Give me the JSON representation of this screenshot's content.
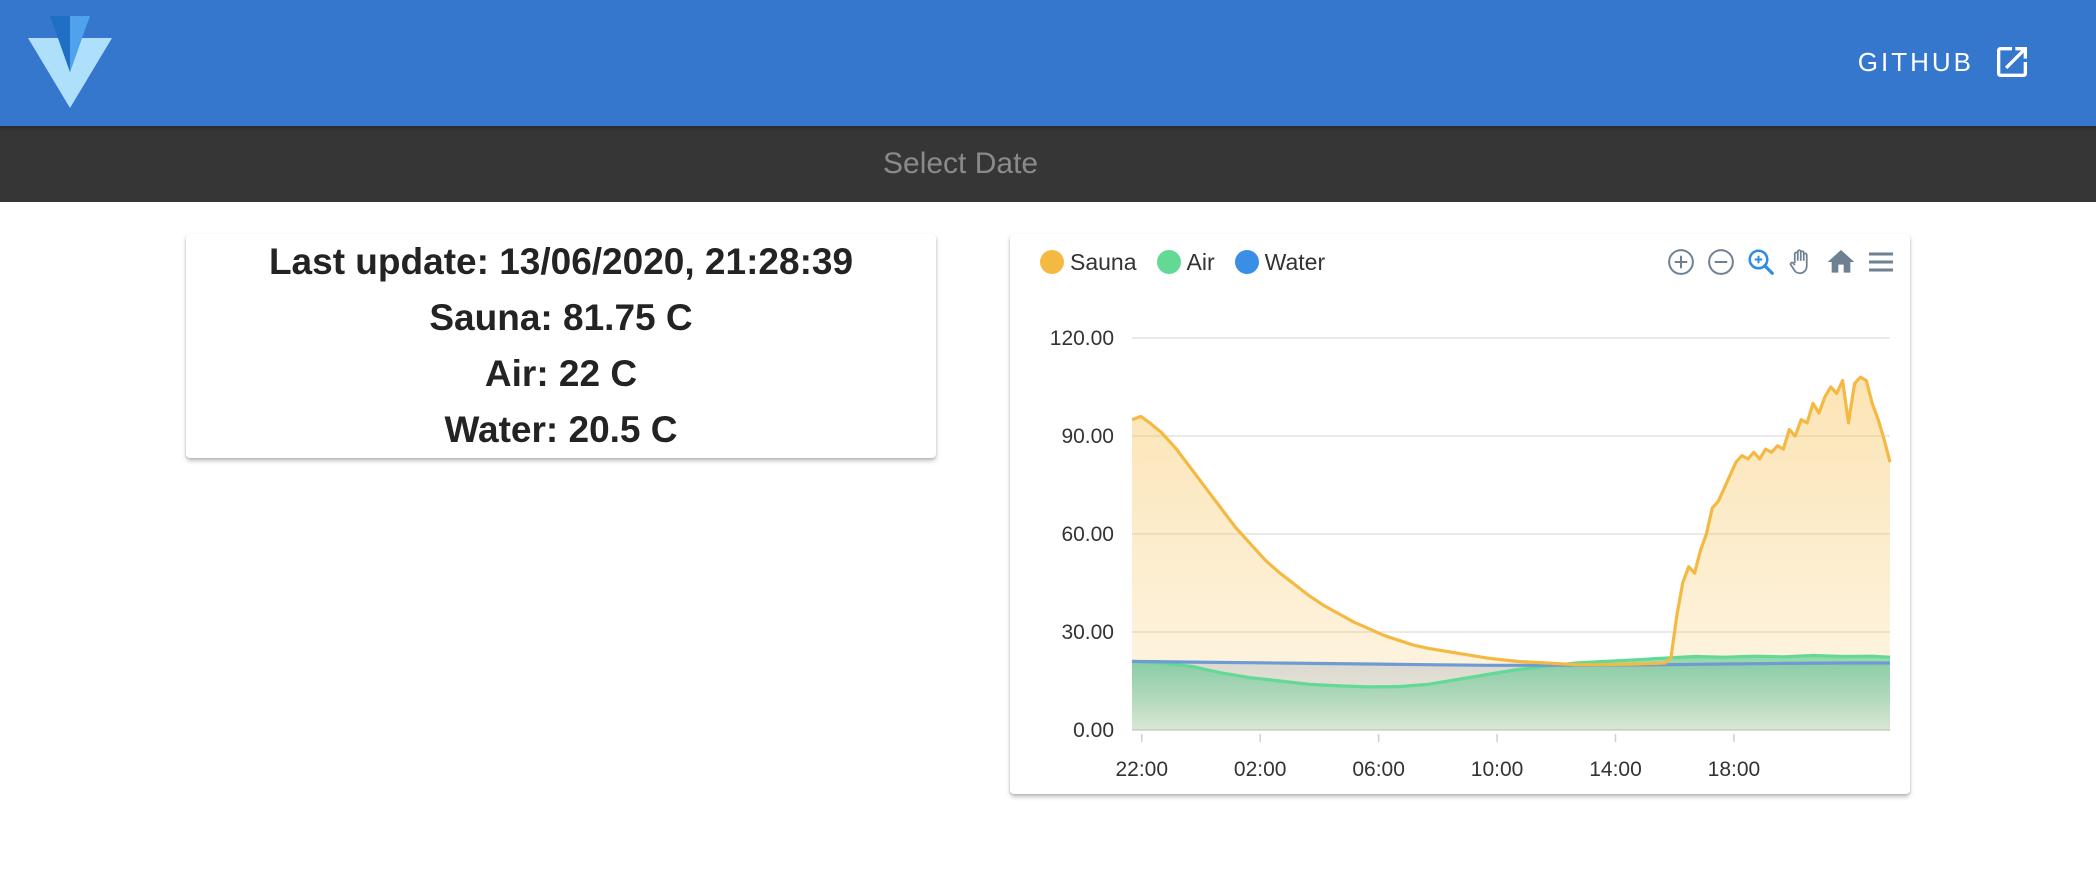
{
  "header": {
    "logo_icon": "vuetify-logo-icon",
    "github_label": "GITHUB",
    "github_icon": "open-in-new-icon",
    "background": "#3477cc"
  },
  "date_picker": {
    "placeholder": "Select Date",
    "value": ""
  },
  "status": {
    "last_update": "Last update: 13/06/2020, 21:28:39",
    "sauna": "Sauna: 81.75 C",
    "air": "Air: 22 C",
    "water": "Water: 20.5 C"
  },
  "toolbar": {
    "icons": [
      "zoom-in-icon",
      "zoom-out-icon",
      "zoom-selection-icon",
      "pan-hand-icon",
      "reset-home-icon",
      "menu-icon"
    ]
  },
  "chart_data": {
    "type": "area",
    "title": "",
    "xlabel": "",
    "ylabel": "",
    "x_ticks": [
      "22:00",
      "02:00",
      "06:00",
      "10:00",
      "14:00",
      "18:00"
    ],
    "y_ticks": [
      "0.00",
      "30.00",
      "60.00",
      "90.00",
      "120.00"
    ],
    "ylim": [
      0,
      120
    ],
    "x_unit": "hours since 21:40",
    "xlim": [
      0,
      24
    ],
    "grid": true,
    "legend_position": "top-left",
    "series": [
      {
        "name": "Sauna",
        "color": "#f4b942",
        "points": [
          [
            0,
            95
          ],
          [
            0.3,
            96
          ],
          [
            0.6,
            94
          ],
          [
            1,
            91
          ],
          [
            1.5,
            86
          ],
          [
            2,
            80
          ],
          [
            2.5,
            74
          ],
          [
            3,
            68
          ],
          [
            3.5,
            62
          ],
          [
            4,
            57
          ],
          [
            4.5,
            52
          ],
          [
            5,
            48
          ],
          [
            5.5,
            44.5
          ],
          [
            6,
            41
          ],
          [
            6.5,
            38
          ],
          [
            7,
            35.5
          ],
          [
            7.5,
            33
          ],
          [
            8,
            31
          ],
          [
            8.5,
            29
          ],
          [
            9,
            27.5
          ],
          [
            9.5,
            26
          ],
          [
            10,
            25
          ],
          [
            11,
            23.5
          ],
          [
            12,
            22
          ],
          [
            13,
            21
          ],
          [
            14,
            20.5
          ],
          [
            15,
            20
          ],
          [
            16,
            20
          ],
          [
            17,
            20.2
          ],
          [
            18,
            20.5
          ],
          [
            19,
            20.8
          ],
          [
            20,
            21.2
          ],
          [
            21,
            21.5
          ],
          [
            22,
            21.8
          ],
          [
            22.5,
            22
          ]
        ],
        "points_extra": [
          [
            18.2,
            22
          ],
          [
            18.4,
            35
          ],
          [
            18.6,
            45
          ],
          [
            18.8,
            50
          ],
          [
            19,
            48
          ],
          [
            19.2,
            55
          ],
          [
            19.4,
            60
          ],
          [
            19.6,
            68
          ],
          [
            19.8,
            70
          ],
          [
            20,
            74
          ],
          [
            20.2,
            78
          ],
          [
            20.4,
            82
          ],
          [
            20.6,
            84
          ],
          [
            20.8,
            83
          ],
          [
            21,
            85
          ],
          [
            21.2,
            83
          ],
          [
            21.4,
            86
          ],
          [
            21.6,
            85
          ],
          [
            21.8,
            87
          ],
          [
            22,
            86
          ],
          [
            22.2,
            92
          ],
          [
            22.4,
            90
          ],
          [
            22.6,
            95
          ],
          [
            22.8,
            94
          ],
          [
            23,
            100
          ],
          [
            23.2,
            97
          ],
          [
            23.4,
            102
          ],
          [
            23.6,
            105
          ],
          [
            23.8,
            103
          ],
          [
            24,
            107
          ],
          [
            24.2,
            94
          ],
          [
            24.4,
            106
          ],
          [
            24.6,
            108
          ],
          [
            24.8,
            107
          ],
          [
            25,
            100
          ],
          [
            25.2,
            95
          ],
          [
            25.4,
            89
          ],
          [
            25.6,
            82
          ]
        ]
      },
      {
        "name": "Air",
        "color": "#63d996",
        "points": [
          [
            0,
            21
          ],
          [
            1,
            20.5
          ],
          [
            2,
            19.5
          ],
          [
            3,
            17.5
          ],
          [
            4,
            16
          ],
          [
            5,
            15
          ],
          [
            6,
            14
          ],
          [
            7,
            13.5
          ],
          [
            8,
            13.2
          ],
          [
            9,
            13.3
          ],
          [
            10,
            14
          ],
          [
            11,
            15.5
          ],
          [
            12,
            17
          ],
          [
            13,
            18.5
          ],
          [
            14,
            19.5
          ],
          [
            15,
            20.5
          ],
          [
            16,
            21
          ],
          [
            17,
            21.5
          ],
          [
            18,
            22
          ],
          [
            19,
            22.5
          ],
          [
            20,
            22.3
          ],
          [
            21,
            22.6
          ],
          [
            22,
            22.4
          ],
          [
            23,
            22.8
          ],
          [
            24,
            22.5
          ],
          [
            25,
            22.6
          ],
          [
            25.6,
            22.3
          ]
        ]
      },
      {
        "name": "Water",
        "color": "#3a8ee6",
        "points": [
          [
            0,
            21
          ],
          [
            2,
            20.8
          ],
          [
            4,
            20.6
          ],
          [
            6,
            20.4
          ],
          [
            8,
            20.2
          ],
          [
            10,
            20
          ],
          [
            12,
            19.8
          ],
          [
            14,
            19.8
          ],
          [
            16,
            19.9
          ],
          [
            18,
            20
          ],
          [
            20,
            20.2
          ],
          [
            22,
            20.4
          ],
          [
            24,
            20.5
          ],
          [
            25.6,
            20.5
          ]
        ]
      }
    ]
  }
}
